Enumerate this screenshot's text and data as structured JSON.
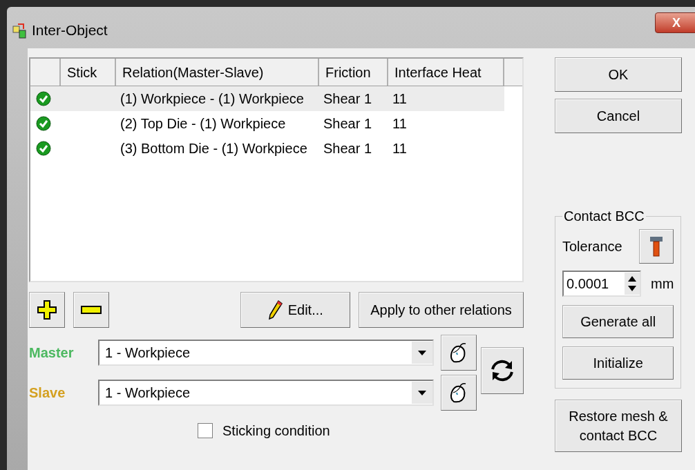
{
  "window": {
    "title": "Inter-Object",
    "close": "X"
  },
  "table": {
    "columns": [
      "Stick",
      "Relation(Master-Slave)",
      "Friction",
      "Interface Heat"
    ],
    "rows": [
      {
        "enabled": true,
        "selected": true,
        "relation": "(1) Workpiece - (1) Workpiece",
        "friction": "Shear 1",
        "heat": "11"
      },
      {
        "enabled": true,
        "selected": false,
        "relation": "(2) Top Die - (1) Workpiece",
        "friction": "Shear 1",
        "heat": "11"
      },
      {
        "enabled": true,
        "selected": false,
        "relation": "(3) Bottom Die - (1) Workpiece",
        "friction": "Shear 1",
        "heat": "11"
      }
    ]
  },
  "list_buttons": {
    "edit": "Edit...",
    "apply": "Apply to other relations"
  },
  "selectors": [
    {
      "label": "Master",
      "color": "#4cb860",
      "value": "1 - Workpiece"
    },
    {
      "label": "Slave",
      "color": "#d4a020",
      "value": "1 - Workpiece"
    }
  ],
  "sticking": {
    "label": "Sticking condition",
    "checked": false
  },
  "dialog_buttons": [
    "OK",
    "Cancel"
  ],
  "contact_bcc": {
    "title": "Contact BCC",
    "tolerance_label": "Tolerance",
    "tolerance": "0.0001",
    "unit": "mm",
    "generate": "Generate all",
    "initialize": "Initialize"
  },
  "restore": "Restore mesh & contact BCC"
}
